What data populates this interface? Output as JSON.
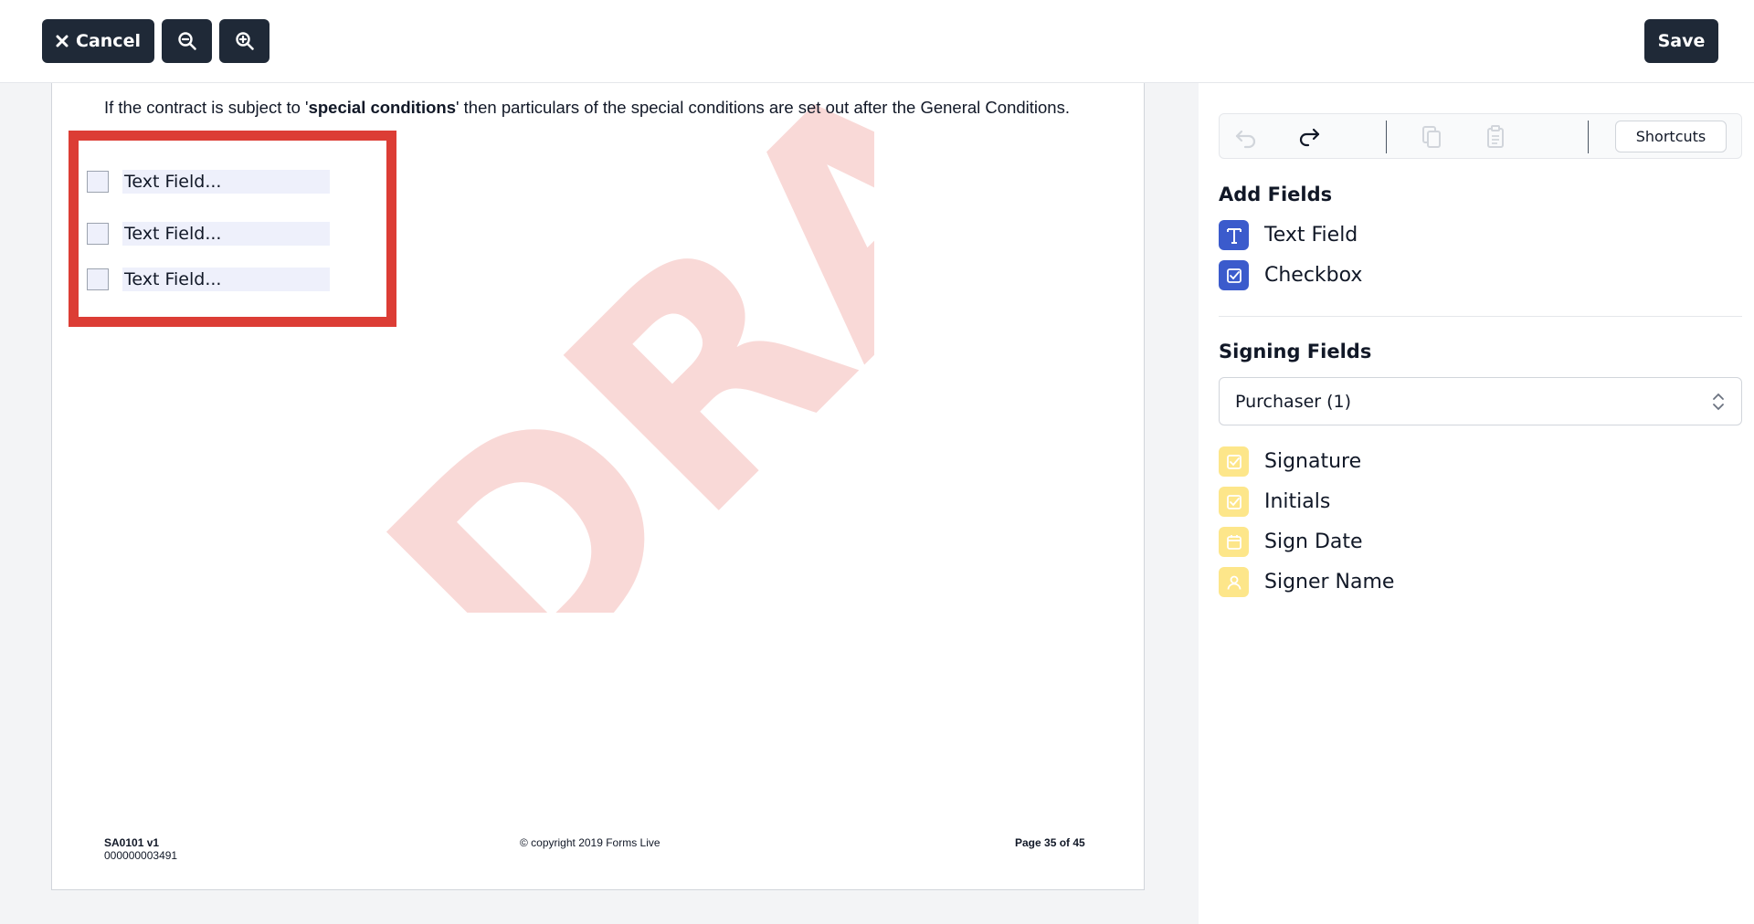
{
  "topbar": {
    "cancel_label": "Cancel",
    "save_label": "Save"
  },
  "document": {
    "intro_prefix": "If the contract is subject to '",
    "intro_bold": "special conditions",
    "intro_suffix": "' then particulars of the special conditions are set out after the General Conditions.",
    "watermark_text": "DRAFT",
    "fields": [
      {
        "placeholder": "Text Field..."
      },
      {
        "placeholder": "Text Field..."
      },
      {
        "placeholder": "Text Field..."
      }
    ],
    "footer": {
      "form_code": "SA0101  v1",
      "form_number": "000000003491",
      "copyright": "© copyright 2019 Forms Live",
      "page_number": "Page 35 of 45"
    }
  },
  "sidebar": {
    "shortcuts_label": "Shortcuts",
    "add_fields_title": "Add Fields",
    "add_fields": [
      {
        "label": "Text Field",
        "icon": "text-field-icon"
      },
      {
        "label": "Checkbox",
        "icon": "checkbox-icon"
      }
    ],
    "signing_fields_title": "Signing Fields",
    "signer_select_value": "Purchaser (1)",
    "signing_fields": [
      {
        "label": "Signature",
        "icon": "signature-icon"
      },
      {
        "label": "Initials",
        "icon": "initials-icon"
      },
      {
        "label": "Sign Date",
        "icon": "calendar-icon"
      },
      {
        "label": "Signer Name",
        "icon": "user-icon"
      }
    ]
  },
  "colors": {
    "dark_button": "#1f2937",
    "accent_blue": "#3b5bcc",
    "accent_yellow": "#fde68a",
    "highlight_red": "#dc3d35",
    "watermark": "#f9d9d7"
  }
}
